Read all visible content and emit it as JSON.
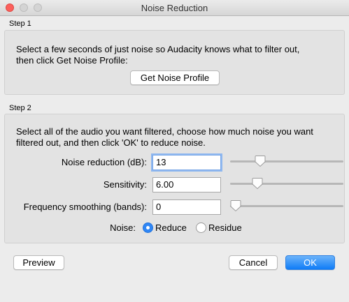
{
  "window": {
    "title": "Noise Reduction"
  },
  "step1": {
    "label": "Step 1",
    "line1": "Select a few seconds of just noise so Audacity knows what to filter out,",
    "line2": "then click Get Noise Profile:",
    "button": "Get Noise Profile"
  },
  "step2": {
    "label": "Step 2",
    "line1": "Select all of the audio you want filtered, choose how much noise you want",
    "line2": "filtered out, and then click 'OK' to reduce noise.",
    "noise_reduction": {
      "label": "Noise reduction (dB):",
      "value": "13",
      "slider": 0.27
    },
    "sensitivity": {
      "label": "Sensitivity:",
      "value": "6.00",
      "slider": 0.25
    },
    "frequency_smoothing": {
      "label": "Frequency smoothing (bands):",
      "value": "0",
      "slider": 0.0
    },
    "noise": {
      "label": "Noise:",
      "reduce": "Reduce",
      "residue": "Residue",
      "selected": "Reduce"
    }
  },
  "buttons": {
    "preview": "Preview",
    "cancel": "Cancel",
    "ok": "OK"
  },
  "colors": {
    "accent": "#0f7cf7",
    "close": "#fc605c"
  }
}
